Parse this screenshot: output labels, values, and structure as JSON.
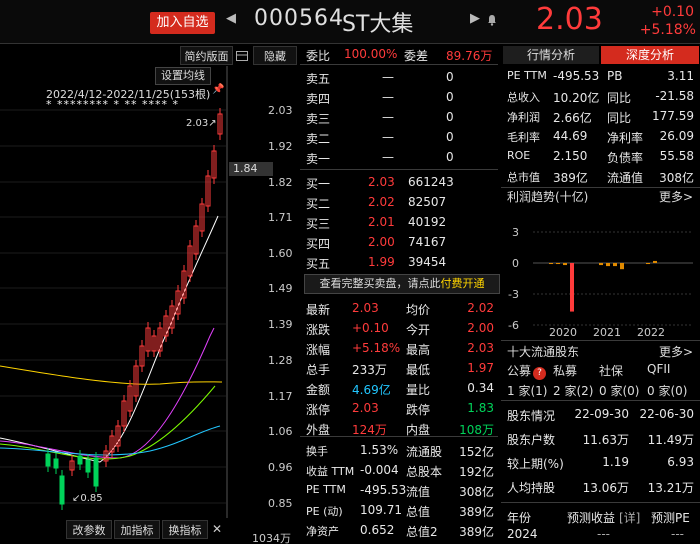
{
  "header": {
    "add_watch": "加入自选",
    "code": "000564",
    "name": "ST大集",
    "price": "2.03",
    "change": "+0.10",
    "change_pct": "+5.18%"
  },
  "chart": {
    "toolbar": {
      "simple": "简约版面",
      "hide": "隐藏",
      "ma_setting": "设置均线"
    },
    "date_range": "2022/4/12-2022/11/25(153根)",
    "star_marks": "* ******** *   **  **** *",
    "price_labels": [
      "2.03",
      "1.92",
      "1.82",
      "1.71",
      "1.60",
      "1.49",
      "1.39",
      "1.28",
      "1.17",
      "1.06",
      "0.96",
      "0.85"
    ],
    "current_price_tag": "1.84",
    "high_label": "2.03",
    "low_label": "0.85",
    "bottom": {
      "change_param": "改参数",
      "add_indicator": "加指标",
      "switch_indicator": "换指标",
      "volume": "1034万"
    }
  },
  "book": {
    "ratio_label": "委比",
    "ratio": "100.00%",
    "diff_label": "委差",
    "diff": "89.76万",
    "asks": [
      {
        "label": "卖五",
        "price": "—",
        "vol": "0"
      },
      {
        "label": "卖四",
        "price": "—",
        "vol": "0"
      },
      {
        "label": "卖三",
        "price": "—",
        "vol": "0"
      },
      {
        "label": "卖二",
        "price": "—",
        "vol": "0"
      },
      {
        "label": "卖一",
        "price": "—",
        "vol": "0"
      }
    ],
    "bids": [
      {
        "label": "买一",
        "price": "2.03",
        "vol": "661243"
      },
      {
        "label": "买二",
        "price": "2.02",
        "vol": "82507"
      },
      {
        "label": "买三",
        "price": "2.01",
        "vol": "40192"
      },
      {
        "label": "买四",
        "price": "2.00",
        "vol": "74167"
      },
      {
        "label": "买五",
        "price": "1.99",
        "vol": "39454"
      }
    ],
    "promo": "查看完整买卖盘，请点此",
    "promo_link": "付费开通",
    "stats": [
      {
        "l1": "最新",
        "v1": "2.03",
        "c1": "red",
        "l2": "均价",
        "v2": "2.02",
        "c2": "red"
      },
      {
        "l1": "涨跌",
        "v1": "+0.10",
        "c1": "red",
        "l2": "今开",
        "v2": "2.00",
        "c2": "red"
      },
      {
        "l1": "涨幅",
        "v1": "+5.18%",
        "c1": "red",
        "l2": "最高",
        "v2": "2.03",
        "c2": "red"
      },
      {
        "l1": "总手",
        "v1": "233万",
        "c1": "white",
        "l2": "最低",
        "v2": "1.97",
        "c2": "red"
      },
      {
        "l1": "金额",
        "v1": "4.69亿",
        "c1": "cyan",
        "l2": "量比",
        "v2": "0.34",
        "c2": "white"
      },
      {
        "l1": "涨停",
        "v1": "2.03",
        "c1": "red",
        "l2": "跌停",
        "v2": "1.83",
        "c2": "green"
      },
      {
        "l1": "外盘",
        "v1": "124万",
        "c1": "red",
        "l2": "内盘",
        "v2": "108万",
        "c2": "green"
      }
    ],
    "stats2": [
      {
        "l1": "换手",
        "v1": "1.53%",
        "l2": "流通股",
        "v2": "152亿"
      },
      {
        "l1": "收益 TTM",
        "v1": "-0.004",
        "l2": "总股本",
        "v2": "192亿"
      },
      {
        "l1": "PE TTM",
        "v1": "-495.53",
        "l2": "流值",
        "v2": "308亿"
      },
      {
        "l1": "PE (动)",
        "v1": "109.71",
        "l2": "总值",
        "v2": "389亿"
      },
      {
        "l1": "净资产",
        "v1": "0.652",
        "l2": "总值2",
        "v2": "389亿"
      }
    ]
  },
  "right": {
    "tabs": [
      "行情分析",
      "深度分析"
    ],
    "fundamentals": [
      {
        "l1": "PE TTM",
        "v1": "-495.53",
        "l2": "PB",
        "v2": "3.11"
      },
      {
        "l1": "总收入",
        "v1": "10.20亿",
        "l2": "同比",
        "v2": "-21.58"
      },
      {
        "l1": "净利润",
        "v1": "2.66亿",
        "l2": "同比",
        "v2": "177.59"
      },
      {
        "l1": "毛利率",
        "v1": "44.69",
        "l2": "净利率",
        "v2": "26.09"
      },
      {
        "l1": "ROE",
        "v1": "2.150",
        "l2": "负债率",
        "v2": "55.58"
      },
      {
        "l1": "总市值",
        "v1": "389亿",
        "l2": "流通值",
        "v2": "308亿"
      }
    ],
    "profit_title": "利润趋势(十亿)",
    "more": "更多",
    "more_arrow": ">",
    "profit_y": [
      "3",
      "0",
      "-3",
      "-6"
    ],
    "profit_years": [
      "2020",
      "2021",
      "2022"
    ],
    "holders_title": "十大流通股东",
    "holder_types": [
      "公募",
      "私募",
      "社保",
      "QFII"
    ],
    "holder_counts": [
      "1 家(1)",
      "2 家(2)",
      "0 家(0)",
      "0 家(0)"
    ],
    "holder_stats": [
      {
        "l": "股东情况",
        "v1": "22-09-30",
        "v2": "22-06-30"
      },
      {
        "l": "股东户数",
        "v1": "11.63万",
        "v2": "11.49万"
      },
      {
        "l": "较上期(%)",
        "v1": "1.19",
        "v2": "6.93"
      },
      {
        "l": "人均持股",
        "v1": "13.06万",
        "v2": "13.21万"
      }
    ],
    "forecast_cols": [
      "年份",
      "预测收益",
      "预测PE"
    ],
    "forecast_row": [
      "2024",
      "---",
      "---"
    ],
    "forecast_tag": "[详]"
  },
  "colors": {
    "up": "#ff3b3b",
    "down": "#00d35a",
    "accent": "#d42b1e",
    "amount": "#22c7ff"
  }
}
